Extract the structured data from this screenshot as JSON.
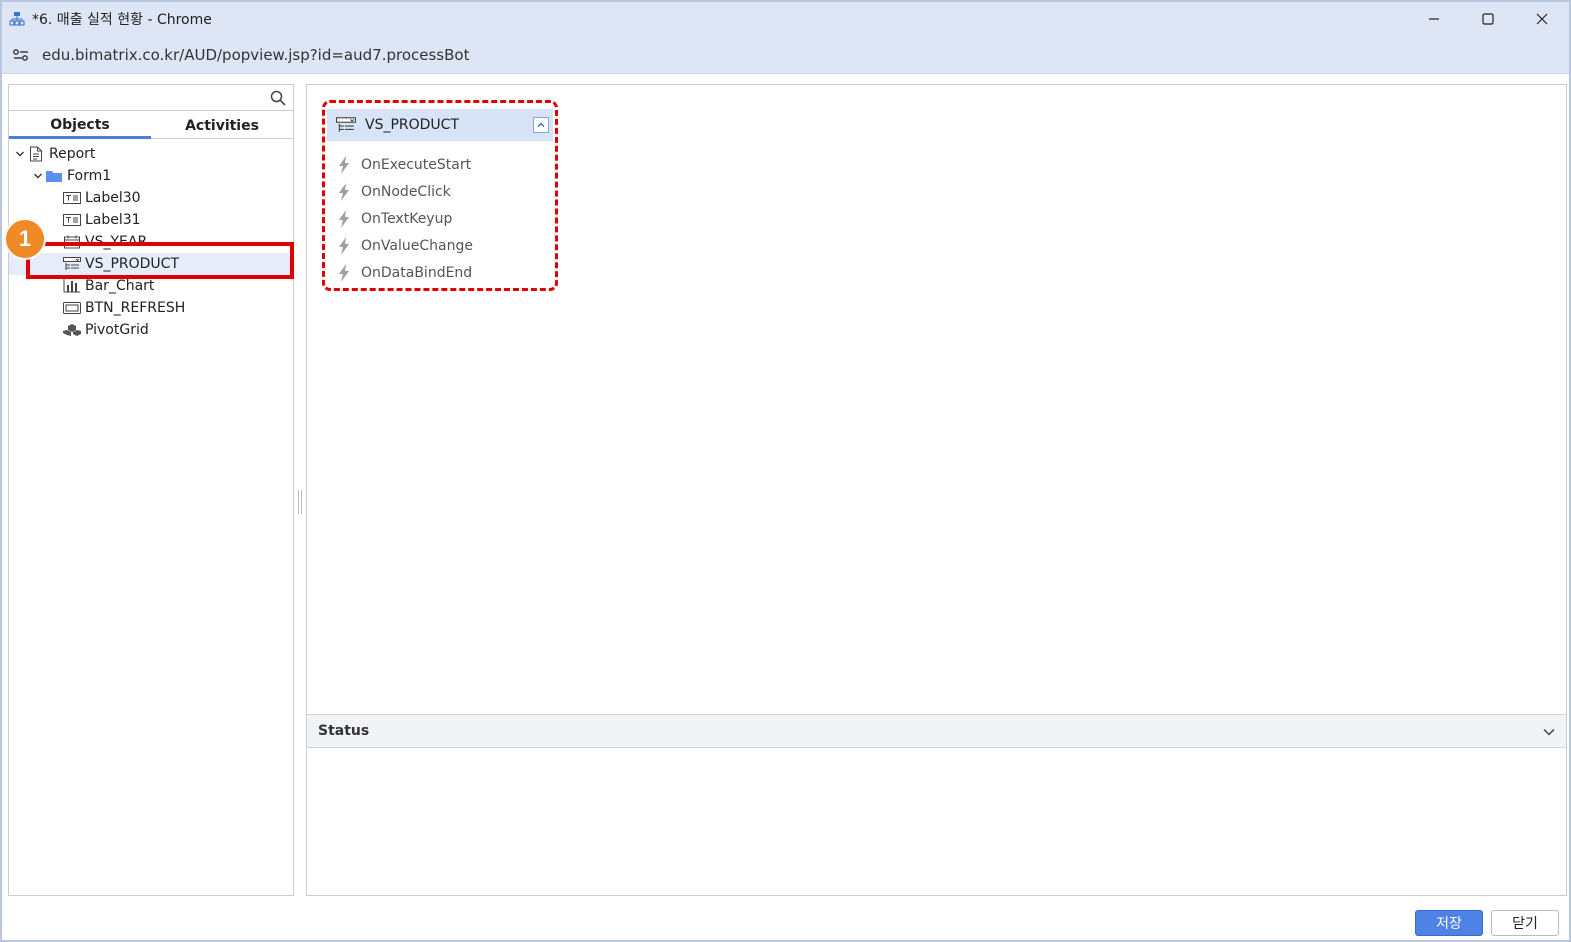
{
  "window": {
    "title": "*6. 매출 실적 현황 - Chrome",
    "url": "edu.bimatrix.co.kr/AUD/popview.jsp?id=aud7.processBot"
  },
  "left": {
    "search_placeholder": "",
    "tabs": [
      {
        "label": "Objects",
        "active": true
      },
      {
        "label": "Activities",
        "active": false
      }
    ],
    "tree": [
      {
        "label": "Report",
        "icon": "document-icon",
        "level": 0,
        "expanded": true
      },
      {
        "label": "Form1",
        "icon": "folder-icon",
        "level": 1,
        "expanded": true
      },
      {
        "label": "Label30",
        "icon": "label-icon",
        "level": 2
      },
      {
        "label": "Label31",
        "icon": "label-icon",
        "level": 2
      },
      {
        "label": "VS_YEAR",
        "icon": "calendar-icon",
        "level": 2
      },
      {
        "label": "VS_PRODUCT",
        "icon": "treeview-icon",
        "level": 2,
        "selected": true
      },
      {
        "label": "Bar_Chart",
        "icon": "bar-chart-icon",
        "level": 2
      },
      {
        "label": "BTN_REFRESH",
        "icon": "button-icon",
        "level": 2
      },
      {
        "label": "PivotGrid",
        "icon": "pivot-icon",
        "level": 2
      }
    ],
    "marker": "1"
  },
  "node": {
    "title": "VS_PRODUCT",
    "events": [
      "OnExecuteStart",
      "OnNodeClick",
      "OnTextKeyup",
      "OnValueChange",
      "OnDataBindEnd"
    ]
  },
  "status": {
    "label": "Status"
  },
  "footer": {
    "save_label": "저장",
    "close_label": "닫기"
  },
  "colors": {
    "highlight": "#e00000",
    "accent": "#4f82e6",
    "marker": "#f08a28",
    "titlebar": "#dee5f5"
  }
}
